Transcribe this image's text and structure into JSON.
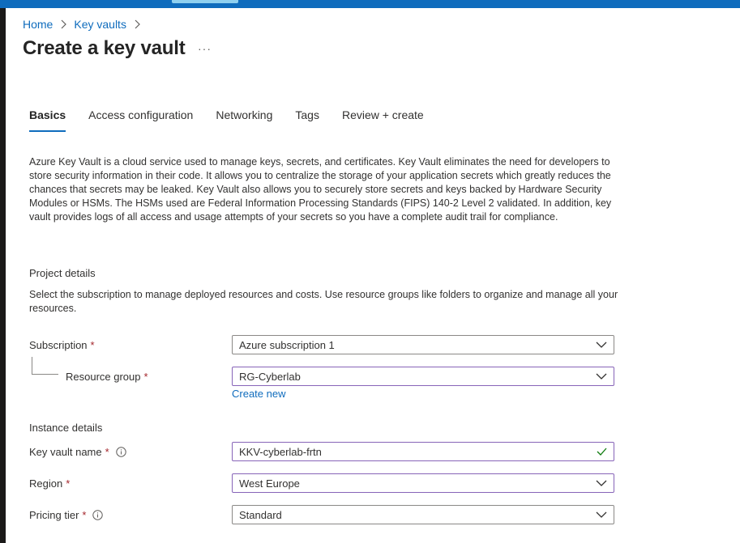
{
  "breadcrumb": {
    "home": "Home",
    "key_vaults": "Key vaults"
  },
  "page": {
    "title": "Create a key vault",
    "more": "···"
  },
  "tabs": [
    {
      "label": "Basics",
      "active": true
    },
    {
      "label": "Access configuration"
    },
    {
      "label": "Networking"
    },
    {
      "label": "Tags"
    },
    {
      "label": "Review + create"
    }
  ],
  "description": "Azure Key Vault is a cloud service used to manage keys, secrets, and certificates. Key Vault eliminates the need for developers to store security information in their code. It allows you to centralize the storage of your application secrets which greatly reduces the chances that secrets may be leaked. Key Vault also allows you to securely store secrets and keys backed by Hardware Security Modules or HSMs. The HSMs used are Federal Information Processing Standards (FIPS) 140-2 Level 2 validated. In addition, key vault provides logs of all access and usage attempts of your secrets so you have a complete audit trail for compliance.",
  "project": {
    "title": "Project details",
    "description": "Select the subscription to manage deployed resources and costs. Use resource groups like folders to organize and manage all your resources."
  },
  "fields": {
    "subscription": {
      "label": "Subscription",
      "required": "*",
      "value": "Azure subscription 1"
    },
    "resource_group": {
      "label": "Resource group",
      "required": "*",
      "value": "RG-Cyberlab",
      "create_new": "Create new"
    },
    "key_vault_name": {
      "label": "Key vault name",
      "required": "*",
      "value": "KKV-cyberlab-frtn"
    },
    "region": {
      "label": "Region",
      "required": "*",
      "value": "West Europe"
    },
    "pricing_tier": {
      "label": "Pricing tier",
      "required": "*",
      "value": "Standard"
    }
  },
  "instance": {
    "title": "Instance details"
  },
  "colors": {
    "accent": "#0f6cbd",
    "required": "#a4262c",
    "focus_border": "#8764b8",
    "valid_check": "#107c10"
  },
  "icons": [
    "chevron-right-icon",
    "chevron-down-icon",
    "info-icon",
    "checkmark-icon"
  ]
}
